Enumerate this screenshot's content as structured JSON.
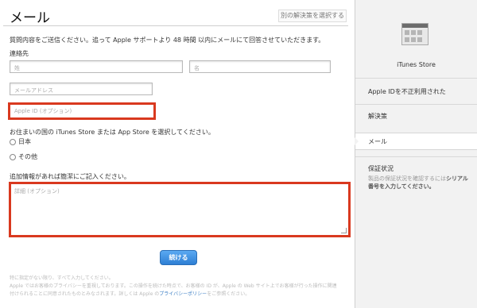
{
  "header": {
    "title": "メール",
    "alt_link": "別の解決策を選択する"
  },
  "form": {
    "intro": "質問内容をご送信ください。追って Apple サポートより 48 時間 以内にメールにて回答させていただきます。",
    "contact_label": "連絡先",
    "last_name_placeholder": "姓",
    "first_name_placeholder": "名",
    "email_placeholder": "メールアドレス",
    "apple_id_placeholder": "Apple ID (オプション)",
    "country_question": "お住まいの国の iTunes Store または App Store を選択してください。",
    "country_options": [
      "日本",
      "その他"
    ],
    "details_question": "追加情報があれば簡潔にご記入ください。",
    "details_placeholder": "詳細 (オプション)",
    "continue_label": "続ける"
  },
  "footer": {
    "line1": "特に指定がない限り、すべて入力してください。",
    "line2": "Apple ではお客様のプライバシーを重視しております。この操作を続けた時点で、お客様の ID が、Apple の Web サイト上でお客様が行った操作に関連",
    "line3_prefix": "付けられることに同意されたものとみなされます。詳しくは Apple の",
    "privacy_link": "プライバシーポリシー",
    "line3_suffix": "をご参照ください。"
  },
  "sidebar": {
    "store_name": "iTunes Store",
    "items": [
      {
        "label": "Apple IDを不正利用された"
      },
      {
        "label": "解決策"
      },
      {
        "label": "メール"
      },
      {
        "label": "保証状況"
      }
    ],
    "warranty_desc_prefix": "製品の保証状況を確認するには",
    "warranty_desc_bold": "シリアル番号を入力してください。"
  },
  "colors": {
    "highlight": "#d9391f",
    "button": "#2e7fd4",
    "link": "#3b7ec4"
  }
}
